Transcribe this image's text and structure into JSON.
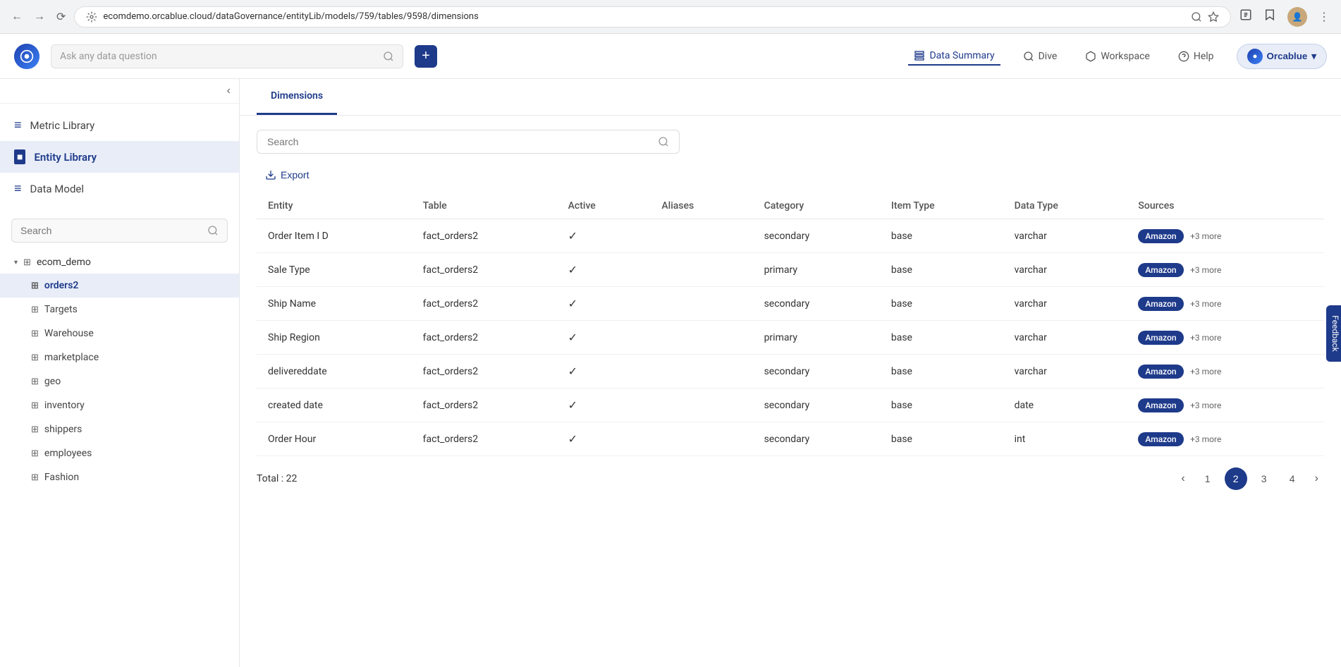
{
  "browser": {
    "url": "ecomdemo.orcablue.cloud/dataGovernance/entityLib/models/759/tables/9598/dimensions",
    "back_title": "Back",
    "forward_title": "Forward",
    "refresh_title": "Refresh"
  },
  "header": {
    "logo_text": "O",
    "search_placeholder": "Ask any data question",
    "add_btn_label": "+",
    "nav": {
      "data_summary": "Data Summary",
      "dive": "Dive",
      "workspace": "Workspace",
      "help": "Help",
      "brand": "Orcablue"
    }
  },
  "sidebar": {
    "collapse_icon": "‹",
    "nav_items": [
      {
        "label": "Metric Library",
        "icon": "≡",
        "active": false
      },
      {
        "label": "Entity Library",
        "icon": "■",
        "active": true
      },
      {
        "label": "Data Model",
        "icon": "≡",
        "active": false
      }
    ],
    "search_placeholder": "Search",
    "tree": {
      "root": "ecom_demo",
      "items": [
        {
          "label": "orders2",
          "active": true
        },
        {
          "label": "Targets",
          "active": false
        },
        {
          "label": "Warehouse",
          "active": false
        },
        {
          "label": "marketplace",
          "active": false
        },
        {
          "label": "geo",
          "active": false
        },
        {
          "label": "inventory",
          "active": false
        },
        {
          "label": "shippers",
          "active": false
        },
        {
          "label": "employees",
          "active": false
        },
        {
          "label": "Fashion",
          "active": false
        }
      ]
    }
  },
  "content": {
    "tabs": [
      {
        "label": "Dimensions",
        "active": true
      }
    ],
    "search_placeholder": "Search",
    "export_label": "Export",
    "table": {
      "columns": [
        "Entity",
        "Table",
        "Active",
        "Aliases",
        "Category",
        "Item Type",
        "Data Type",
        "Sources"
      ],
      "rows": [
        {
          "entity": "Order Item I D",
          "table": "fact_orders2",
          "active": true,
          "aliases": "",
          "category": "secondary",
          "item_type": "base",
          "data_type": "varchar",
          "source": "Amazon",
          "more": "+3 more"
        },
        {
          "entity": "Sale Type",
          "table": "fact_orders2",
          "active": true,
          "aliases": "",
          "category": "primary",
          "item_type": "base",
          "data_type": "varchar",
          "source": "Amazon",
          "more": "+3 more"
        },
        {
          "entity": "Ship Name",
          "table": "fact_orders2",
          "active": true,
          "aliases": "",
          "category": "secondary",
          "item_type": "base",
          "data_type": "varchar",
          "source": "Amazon",
          "more": "+3 more"
        },
        {
          "entity": "Ship Region",
          "table": "fact_orders2",
          "active": true,
          "aliases": "",
          "category": "primary",
          "item_type": "base",
          "data_type": "varchar",
          "source": "Amazon",
          "more": "+3 more"
        },
        {
          "entity": "delivereddate",
          "table": "fact_orders2",
          "active": true,
          "aliases": "",
          "category": "secondary",
          "item_type": "base",
          "data_type": "varchar",
          "source": "Amazon",
          "more": "+3 more"
        },
        {
          "entity": "created date",
          "table": "fact_orders2",
          "active": true,
          "aliases": "",
          "category": "secondary",
          "item_type": "base",
          "data_type": "date",
          "source": "Amazon",
          "more": "+3 more"
        },
        {
          "entity": "Order Hour",
          "table": "fact_orders2",
          "active": true,
          "aliases": "",
          "category": "secondary",
          "item_type": "base",
          "data_type": "int",
          "source": "Amazon",
          "more": "+3 more"
        }
      ]
    },
    "pagination": {
      "total_label": "Total :  22",
      "pages": [
        "1",
        "2",
        "3",
        "4"
      ],
      "current_page": 2,
      "prev_label": "‹",
      "next_label": "›"
    }
  },
  "feedback": {
    "label": "Feedback"
  }
}
